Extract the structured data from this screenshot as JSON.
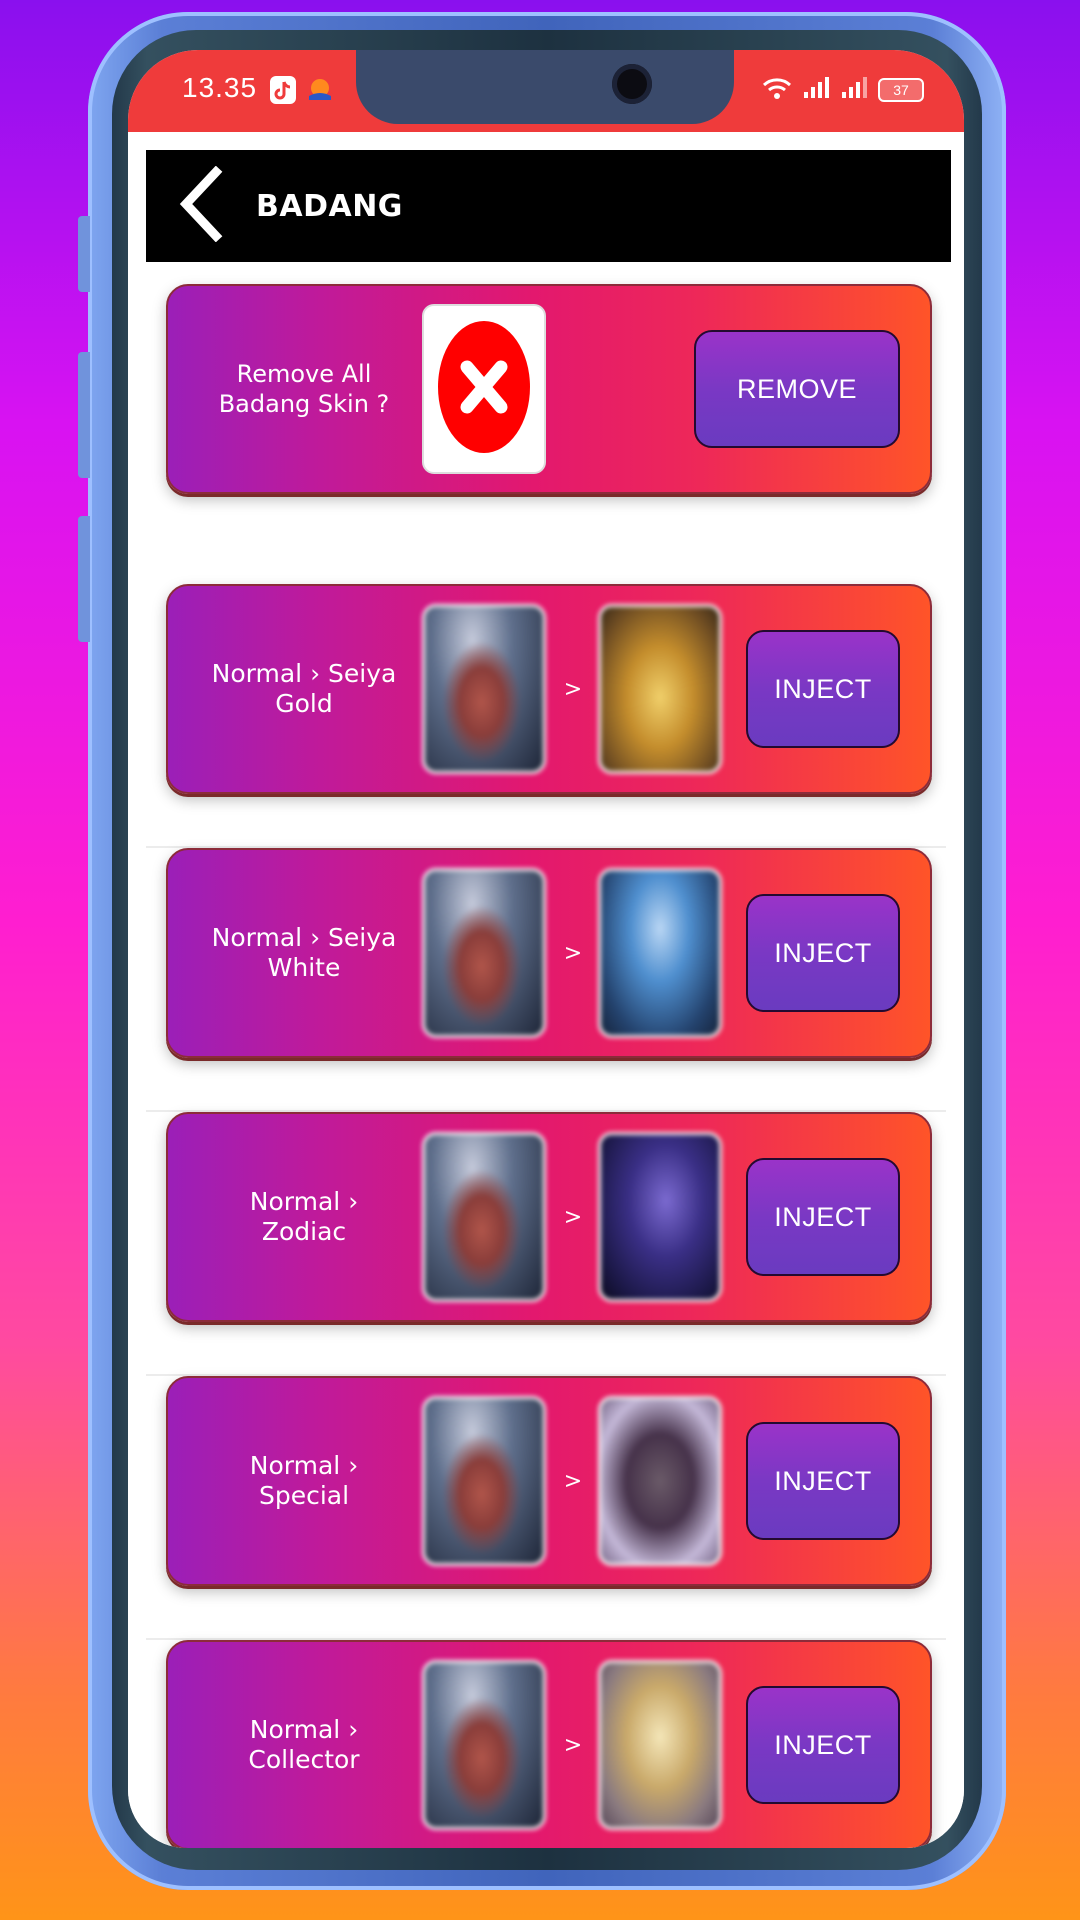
{
  "status_bar": {
    "time": "13.35",
    "battery": "37",
    "app_icons": [
      "tiktok-shop-icon",
      "shopee-icon"
    ],
    "right_icons": [
      "wifi-icon",
      "signal-icon",
      "signal-icon"
    ]
  },
  "app_bar": {
    "title": "BADANG",
    "back_icon": "chevron-left-icon"
  },
  "remove_card": {
    "label": "Remove All\nBadang Skin ?",
    "icon": "x-circle-icon",
    "button": "REMOVE"
  },
  "skins": [
    {
      "label": "Normal › Seiya\nGold",
      "arrow": ">",
      "button": "INJECT"
    },
    {
      "label": "Normal › Seiya\nWhite",
      "arrow": ">",
      "button": "INJECT"
    },
    {
      "label": "Normal ›\nZodiac",
      "arrow": ">",
      "button": "INJECT"
    },
    {
      "label": "Normal ›\nSpecial",
      "arrow": ">",
      "button": "INJECT"
    },
    {
      "label": "Normal ›\nCollector",
      "arrow": ">",
      "button": "INJECT"
    }
  ],
  "colors": {
    "status_bar": "#ef3b3b",
    "app_bar": "#000000",
    "card_start": "#9b1fb8",
    "card_mid": "#e3186e",
    "card_end": "#ff5428",
    "button": "#7a38c4",
    "remove_icon": "#ff0000"
  }
}
